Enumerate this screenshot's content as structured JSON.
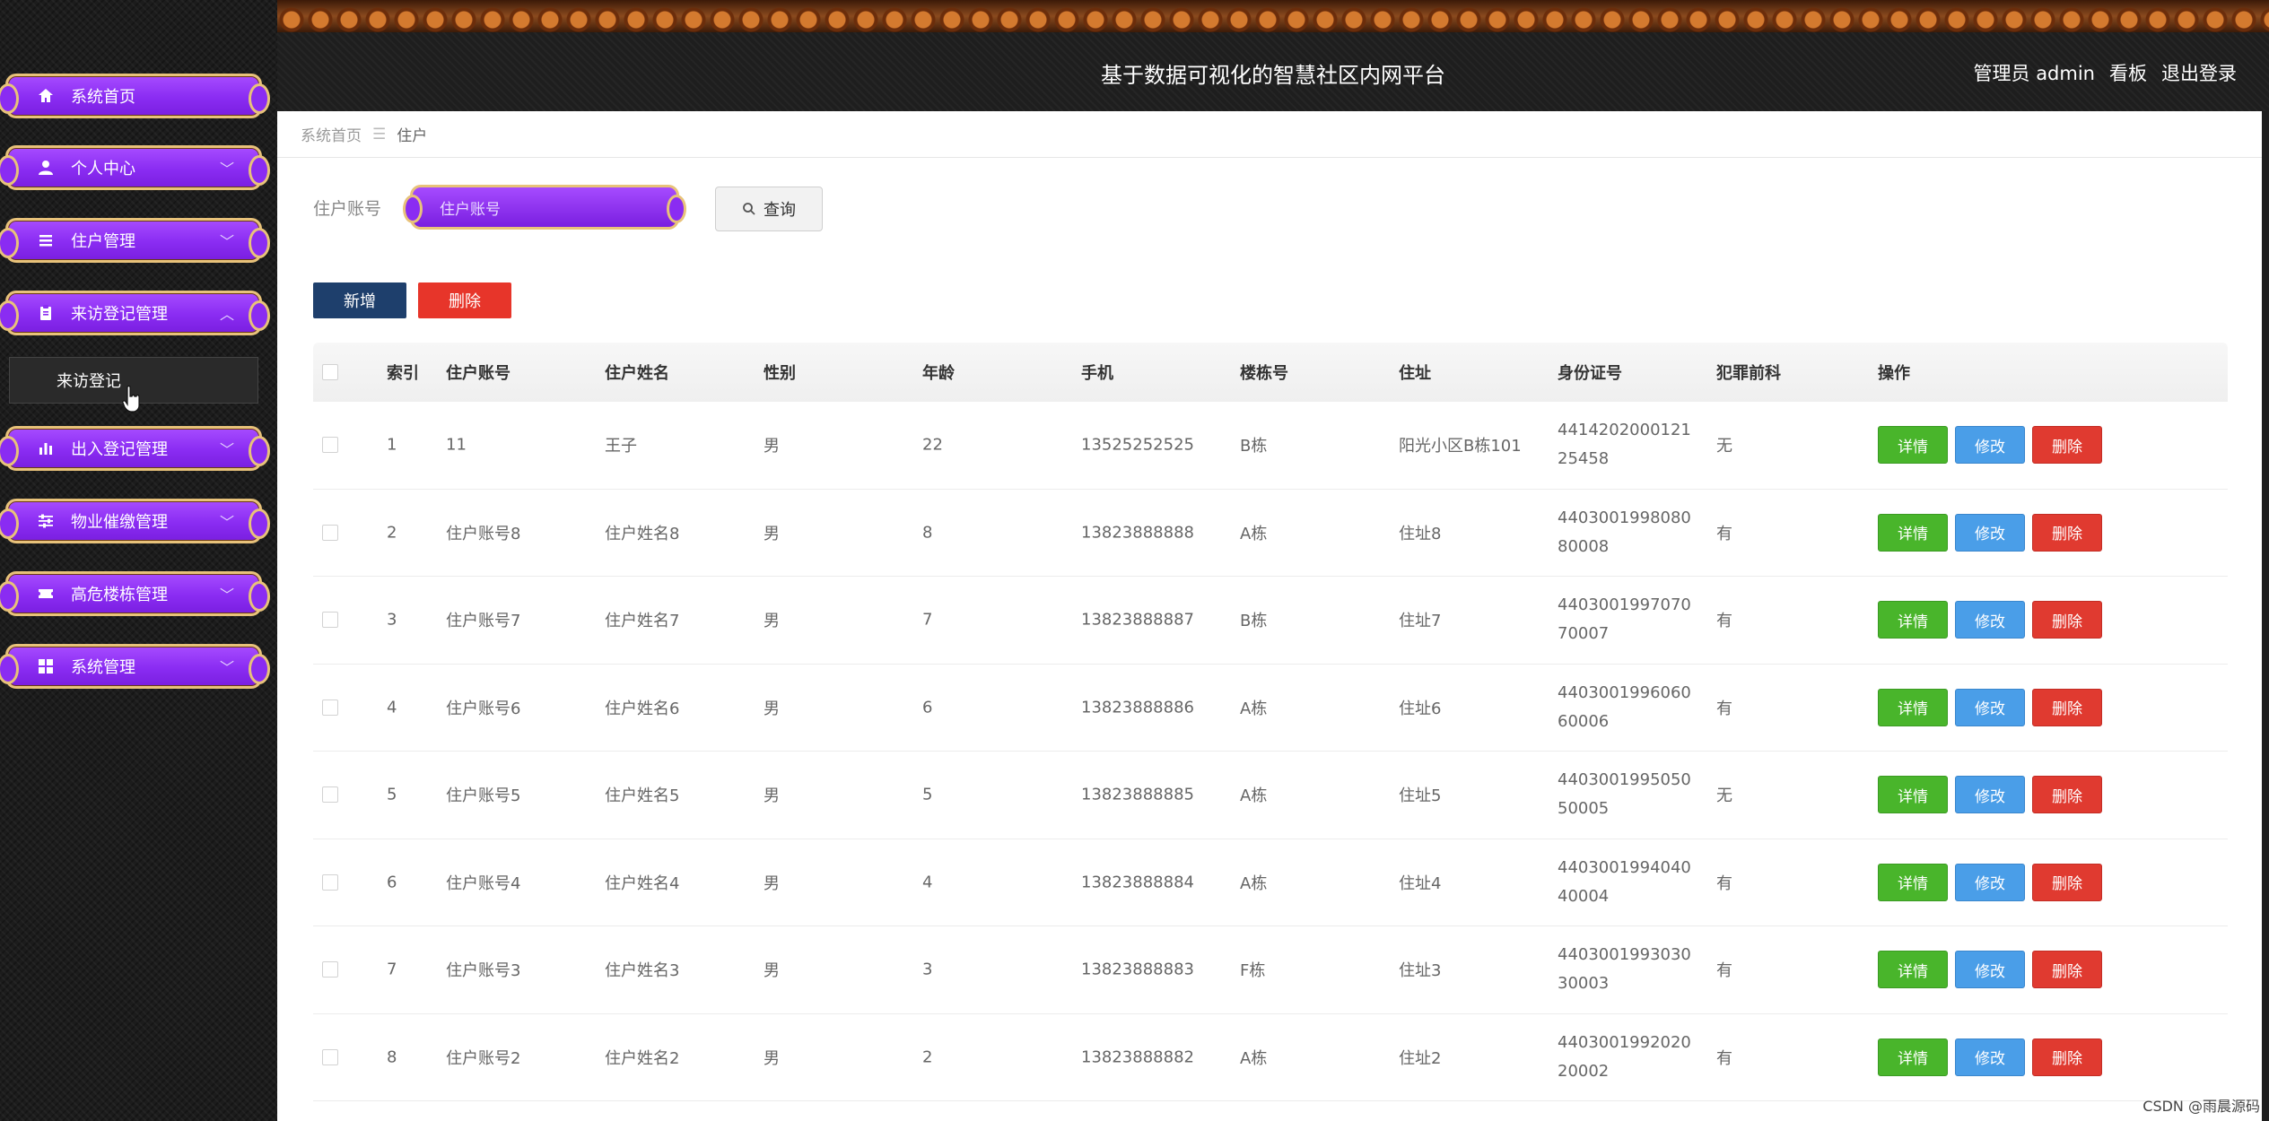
{
  "header": {
    "title": "基于数据可视化的智慧社区内网平台",
    "admin_label": "管理员 admin",
    "board_label": "看板",
    "logout_label": "退出登录"
  },
  "sidebar": {
    "items": [
      {
        "label": "系统首页",
        "icon": "home-icon"
      },
      {
        "label": "个人中心",
        "icon": "user-icon"
      },
      {
        "label": "住户管理",
        "icon": "list-icon"
      },
      {
        "label": "来访登记管理",
        "icon": "clipboard-icon"
      },
      {
        "label": "出入登记管理",
        "icon": "bar-chart-icon"
      },
      {
        "label": "物业催缴管理",
        "icon": "sliders-icon"
      },
      {
        "label": "高危楼栋管理",
        "icon": "ticket-icon"
      },
      {
        "label": "系统管理",
        "icon": "grid-icon"
      }
    ],
    "submenu_item": "来访登记"
  },
  "breadcrumb": {
    "home": "系统首页",
    "separator": "☰",
    "current": "住户"
  },
  "search": {
    "label": "住户账号",
    "placeholder": "住户账号",
    "button": "查询"
  },
  "actions": {
    "add": "新增",
    "delete": "删除"
  },
  "table": {
    "columns": [
      "索引",
      "住户账号",
      "住户姓名",
      "性别",
      "年龄",
      "手机",
      "楼栋号",
      "住址",
      "身份证号",
      "犯罪前科",
      "操作"
    ],
    "rows": [
      {
        "index": "1",
        "account": "11",
        "name": "王子",
        "gender": "男",
        "age": "22",
        "phone": "13525252525",
        "building": "B栋",
        "address": "阳光小区B栋101",
        "id1": "4414202000121",
        "id2": "25458",
        "record": "无"
      },
      {
        "index": "2",
        "account": "住户账号8",
        "name": "住户姓名8",
        "gender": "男",
        "age": "8",
        "phone": "13823888888",
        "building": "A栋",
        "address": "住址8",
        "id1": "4403001998080",
        "id2": "80008",
        "record": "有"
      },
      {
        "index": "3",
        "account": "住户账号7",
        "name": "住户姓名7",
        "gender": "男",
        "age": "7",
        "phone": "13823888887",
        "building": "B栋",
        "address": "住址7",
        "id1": "4403001997070",
        "id2": "70007",
        "record": "有"
      },
      {
        "index": "4",
        "account": "住户账号6",
        "name": "住户姓名6",
        "gender": "男",
        "age": "6",
        "phone": "13823888886",
        "building": "A栋",
        "address": "住址6",
        "id1": "4403001996060",
        "id2": "60006",
        "record": "有"
      },
      {
        "index": "5",
        "account": "住户账号5",
        "name": "住户姓名5",
        "gender": "男",
        "age": "5",
        "phone": "13823888885",
        "building": "A栋",
        "address": "住址5",
        "id1": "4403001995050",
        "id2": "50005",
        "record": "无"
      },
      {
        "index": "6",
        "account": "住户账号4",
        "name": "住户姓名4",
        "gender": "男",
        "age": "4",
        "phone": "13823888884",
        "building": "A栋",
        "address": "住址4",
        "id1": "4403001994040",
        "id2": "40004",
        "record": "有"
      },
      {
        "index": "7",
        "account": "住户账号3",
        "name": "住户姓名3",
        "gender": "男",
        "age": "3",
        "phone": "13823888883",
        "building": "F栋",
        "address": "住址3",
        "id1": "4403001993030",
        "id2": "30003",
        "record": "有"
      },
      {
        "index": "8",
        "account": "住户账号2",
        "name": "住户姓名2",
        "gender": "男",
        "age": "2",
        "phone": "13823888882",
        "building": "A栋",
        "address": "住址2",
        "id1": "4403001992020",
        "id2": "20002",
        "record": "有"
      }
    ],
    "row_buttons": {
      "detail": "详情",
      "edit": "修改",
      "remove": "删除"
    }
  },
  "watermark": "CSDN @雨晨源码",
  "colors": {
    "menu_purple": "#8a2cf2",
    "menu_border": "#e8c27a",
    "btn_green": "#49b52b",
    "btn_blue": "#4a9ee8",
    "btn_red": "#e03a30",
    "btn_navy": "#1e3f6c"
  }
}
